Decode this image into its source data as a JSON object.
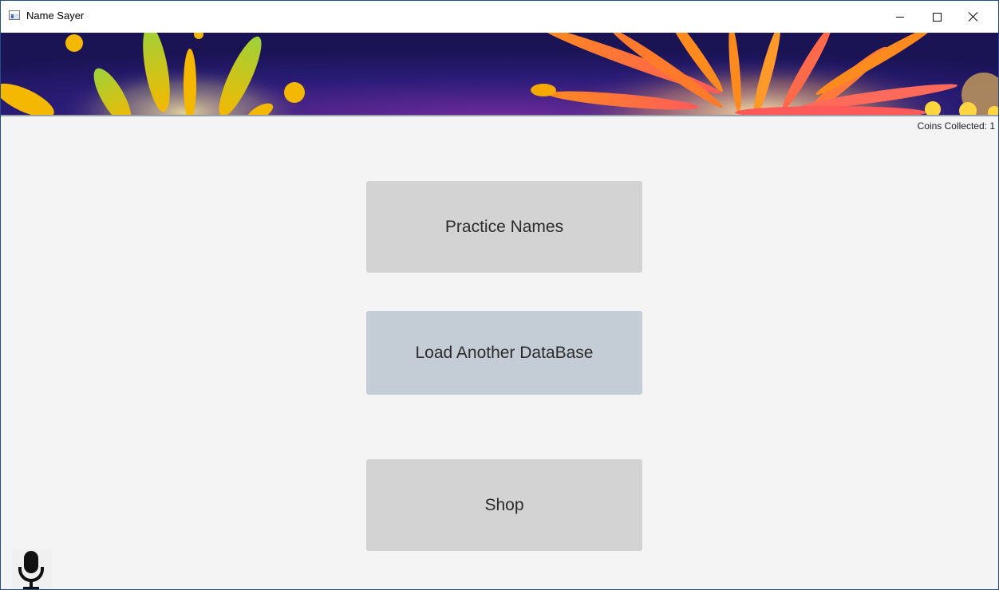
{
  "window": {
    "title": "Name Sayer"
  },
  "status": {
    "coins_label": "Coins Collected: 1"
  },
  "menu": {
    "practice_label": "Practice Names",
    "load_label": "Load Another DataBase",
    "shop_label": "Shop"
  },
  "icons": {
    "app": "app-window-icon",
    "minimize": "minimize-icon",
    "maximize": "maximize-icon",
    "close": "close-icon",
    "mic": "microphone-icon"
  },
  "colors": {
    "banner_background": "#2a1a6e",
    "button_gray": "#d3d3d3",
    "button_hover": "#c4cdd6",
    "content_background": "#f4f4f4"
  }
}
